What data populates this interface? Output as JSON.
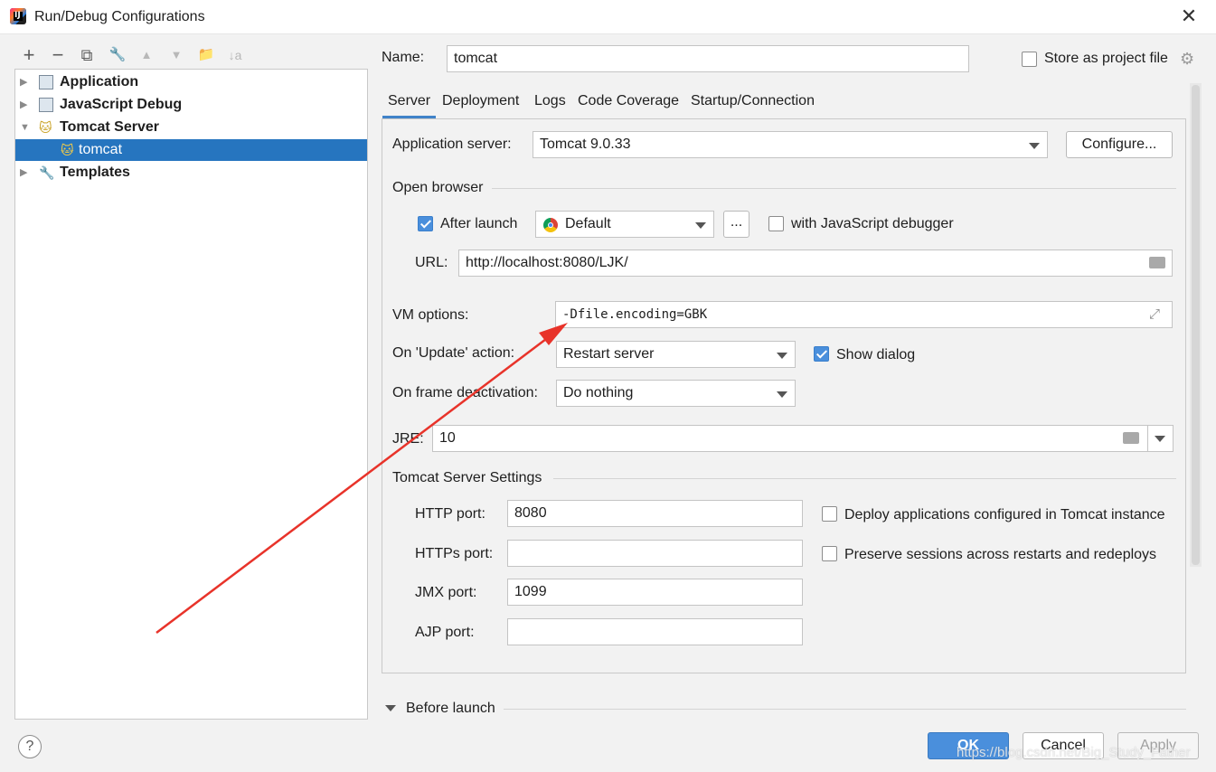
{
  "window": {
    "title": "Run/Debug Configurations",
    "app_icon_letter": "IJ"
  },
  "toolbar": {
    "add": "+",
    "remove": "−",
    "copy": "⧉",
    "edit_defaults": "🔧",
    "move_up": "▲",
    "move_down": "▼",
    "folder": "📁",
    "sort": "↓a"
  },
  "tree": {
    "items": [
      {
        "label": "Application",
        "expanded": false
      },
      {
        "label": "JavaScript Debug",
        "expanded": false
      },
      {
        "label": "Tomcat Server",
        "expanded": true
      },
      {
        "label": "tomcat",
        "selected": true
      },
      {
        "label": "Templates",
        "expanded": false
      }
    ]
  },
  "header": {
    "name_label": "Name:",
    "name_value": "tomcat",
    "store_label": "Store as project file",
    "store_checked": false
  },
  "tabs": [
    "Server",
    "Deployment",
    "Logs",
    "Code Coverage",
    "Startup/Connection"
  ],
  "active_tab": "Server",
  "server": {
    "app_server_label": "Application server:",
    "app_server_value": "Tomcat 9.0.33",
    "configure_button": "Configure...",
    "open_browser_label": "Open browser",
    "after_launch_label": "After launch",
    "after_launch_checked": true,
    "browser_value": "Default",
    "ellipsis_button": "...",
    "js_debugger_label": "with JavaScript debugger",
    "js_debugger_checked": false,
    "url_label": "URL:",
    "url_value": "http://localhost:8080/LJK/",
    "vm_options_label": "VM options:",
    "vm_options_value": "-Dfile.encoding=GBK",
    "on_update_label": "On 'Update' action:",
    "on_update_value": "Restart server",
    "show_dialog_label": "Show dialog",
    "show_dialog_checked": true,
    "on_frame_label": "On frame deactivation:",
    "on_frame_value": "Do nothing",
    "jre_label": "JRE:",
    "jre_value": "10",
    "tomcat_settings_label": "Tomcat Server Settings",
    "http_port_label": "HTTP port:",
    "http_port_value": "8080",
    "https_port_label": "HTTPs port:",
    "https_port_value": "",
    "jmx_port_label": "JMX port:",
    "jmx_port_value": "1099",
    "ajp_port_label": "AJP port:",
    "ajp_port_value": "",
    "deploy_apps_label": "Deploy applications configured in Tomcat instance",
    "deploy_apps_checked": false,
    "preserve_sessions_label": "Preserve sessions across restarts and redeploys",
    "preserve_sessions_checked": false
  },
  "before_launch_label": "Before launch",
  "footer": {
    "help": "?",
    "ok": "OK",
    "cancel": "Cancel",
    "apply": "Apply"
  },
  "watermark": "https://blog.csdn.net/Big_Study_Father",
  "annotation": {
    "color": "#e8332a"
  }
}
